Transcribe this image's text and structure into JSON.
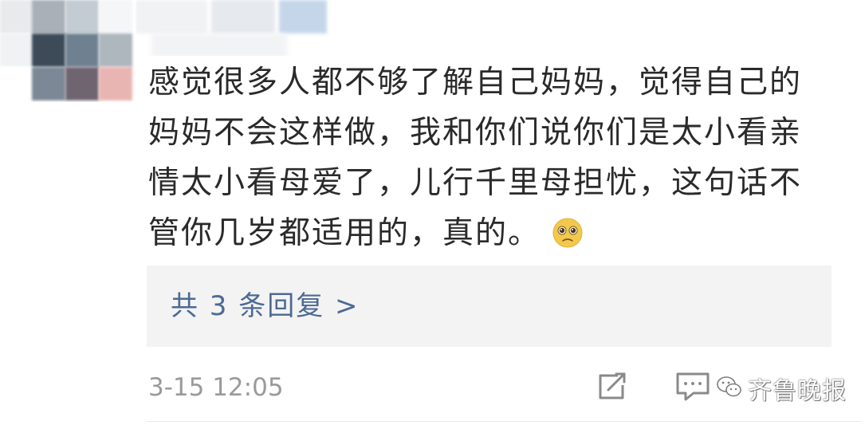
{
  "comment": {
    "text": "感觉很多人都不够了解自己妈妈，觉得自己的妈妈不会这样做，我和你们说你们是太小看亲情太小看母爱了，儿行千里母担忧，这句话不管你几岁都适用的，真的。",
    "emoji": "pleading-face-emoji"
  },
  "replies": {
    "label": "共 3 条回复 >"
  },
  "footer": {
    "timestamp": "3-15 12:05",
    "share_icon": "share-icon",
    "comment_icon": "comment-icon"
  },
  "watermark": {
    "text": "齐鲁晚报"
  },
  "colors": {
    "link": "#4c6a94",
    "reply_bg": "#f3f3f3",
    "timestamp": "#9a9a9a",
    "emoji_face": "#f2c94c"
  }
}
